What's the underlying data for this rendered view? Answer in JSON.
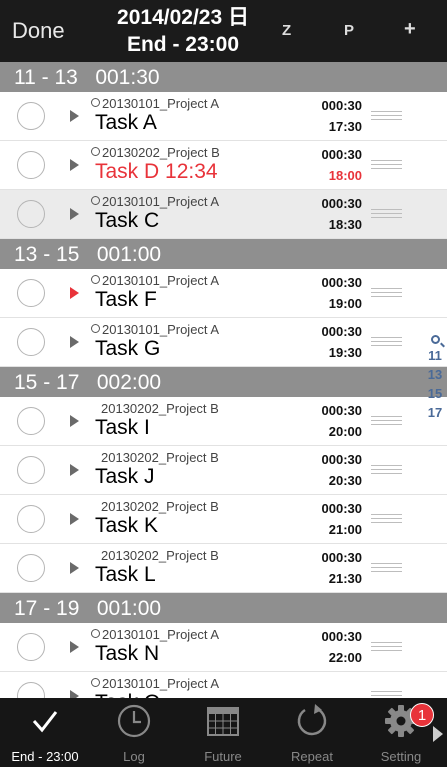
{
  "header": {
    "done_label": "Done",
    "title_date": "2014/02/23 日",
    "title_sub": "End - 23:00",
    "z_label": "Z",
    "p_label": "P",
    "add_label": "+"
  },
  "sections": [
    {
      "label": "11 - 13   001:30",
      "rows": [
        {
          "project": "20130101_Project A",
          "project_icon": true,
          "name": "Task A",
          "name_red": false,
          "duration": "000:30",
          "end": "17:30",
          "end_red": false,
          "arrow_red": false,
          "selected": false
        },
        {
          "project": "20130202_Project B",
          "project_icon": true,
          "name": "Task D 12:34",
          "name_red": true,
          "duration": "000:30",
          "end": "18:00",
          "end_red": true,
          "arrow_red": false,
          "selected": false
        },
        {
          "project": "20130101_Project A",
          "project_icon": true,
          "name": "Task C",
          "name_red": false,
          "duration": "000:30",
          "end": "18:30",
          "end_red": false,
          "arrow_red": false,
          "selected": true
        }
      ]
    },
    {
      "label": "13 - 15   001:00",
      "rows": [
        {
          "project": "20130101_Project A",
          "project_icon": true,
          "name": "Task F",
          "name_red": false,
          "duration": "000:30",
          "end": "19:00",
          "end_red": false,
          "arrow_red": true,
          "selected": false
        },
        {
          "project": "20130101_Project A",
          "project_icon": true,
          "name": "Task G",
          "name_red": false,
          "duration": "000:30",
          "end": "19:30",
          "end_red": false,
          "arrow_red": false,
          "selected": false
        }
      ]
    },
    {
      "label": "15 - 17   002:00",
      "rows": [
        {
          "project": "20130202_Project B",
          "project_icon": false,
          "name": "Task I",
          "name_red": false,
          "duration": "000:30",
          "end": "20:00",
          "end_red": false,
          "arrow_red": false,
          "selected": false
        },
        {
          "project": "20130202_Project B",
          "project_icon": false,
          "name": "Task J",
          "name_red": false,
          "duration": "000:30",
          "end": "20:30",
          "end_red": false,
          "arrow_red": false,
          "selected": false
        },
        {
          "project": "20130202_Project B",
          "project_icon": false,
          "name": "Task K",
          "name_red": false,
          "duration": "000:30",
          "end": "21:00",
          "end_red": false,
          "arrow_red": false,
          "selected": false
        },
        {
          "project": "20130202_Project B",
          "project_icon": false,
          "name": "Task L",
          "name_red": false,
          "duration": "000:30",
          "end": "21:30",
          "end_red": false,
          "arrow_red": false,
          "selected": false
        }
      ]
    },
    {
      "label": "17 - 19   001:00",
      "rows": [
        {
          "project": "20130101_Project A",
          "project_icon": true,
          "name": "Task N",
          "name_red": false,
          "duration": "000:30",
          "end": "22:00",
          "end_red": false,
          "arrow_red": false,
          "selected": false
        },
        {
          "project": "20130101_Project A",
          "project_icon": true,
          "name": "Task O",
          "name_red": false,
          "duration": "",
          "end": "",
          "end_red": false,
          "arrow_red": false,
          "selected": false
        }
      ]
    }
  ],
  "index": {
    "search_icon": "search-icon",
    "items": [
      "11",
      "13",
      "15",
      "17"
    ]
  },
  "tabbar": {
    "tabs": [
      {
        "label": "End - 23:00",
        "icon": "checkmark-icon",
        "active": true
      },
      {
        "label": "Log",
        "icon": "clock-icon",
        "active": false
      },
      {
        "label": "Future",
        "icon": "calendar-icon",
        "active": false
      },
      {
        "label": "Repeat",
        "icon": "repeat-icon",
        "active": false
      },
      {
        "label": "Setting",
        "icon": "gear-icon",
        "active": false
      }
    ],
    "setting_badge": "1"
  },
  "colors": {
    "accent_red": "#e8333a",
    "header_bg": "#1b1b1b",
    "section_bg": "#8f8f8f",
    "index_blue": "#4a6a98"
  }
}
